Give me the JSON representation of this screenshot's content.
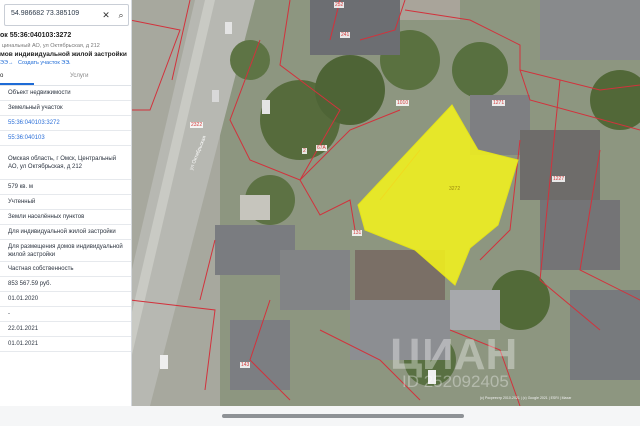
{
  "search": {
    "value": "54.986682 73.385109"
  },
  "panel": {
    "title": "ок 55:36:040103:3272",
    "subtitle": "цинальный АО, ул Октябрьская, д 212",
    "type_label": "мов индивидуальной жилой застройки",
    "links": [
      "ЭЭ",
      "Создать участок ЭЭ"
    ],
    "tabs": [
      {
        "label": "о"
      },
      {
        "label": "Услуги"
      }
    ],
    "rows": [
      {
        "text": "Объект недвижимости",
        "blue": false,
        "h": 1
      },
      {
        "text": "Земельный участок",
        "blue": false,
        "h": 1
      },
      {
        "text": "55:36:040103:3272",
        "blue": true,
        "h": 1
      },
      {
        "text": "55:36:040103",
        "blue": true,
        "h": 1
      },
      {
        "text": "Омская область, г Омск, Центральный АО, ул Октябрьская, д 212",
        "blue": false,
        "h": 3
      },
      {
        "text": "579 кв. м",
        "blue": false,
        "h": 1
      },
      {
        "text": "Учтенный",
        "blue": false,
        "h": 1
      },
      {
        "text": "Земли населённых пунктов",
        "blue": false,
        "h": 1
      },
      {
        "text": "Для индивидуальной жилой застройки",
        "blue": false,
        "h": 1
      },
      {
        "text": "Для размещения домов индивидуальной жилой застройки",
        "blue": false,
        "h": 2
      },
      {
        "text": "Частная собственность",
        "blue": false,
        "h": 1
      },
      {
        "text": "853 567.59 руб.",
        "blue": false,
        "h": 1
      },
      {
        "text": "01.01.2020",
        "blue": false,
        "h": 1
      },
      {
        "text": "-",
        "blue": false,
        "h": 1
      },
      {
        "text": "22.01.2021",
        "blue": false,
        "h": 1
      },
      {
        "text": "01.01.2021",
        "blue": false,
        "h": 1
      }
    ]
  },
  "map": {
    "labels": [
      "252",
      "241",
      "1010",
      "1271",
      "1227",
      "3272",
      "131",
      "67А",
      "2322",
      "143",
      "2",
      "1227"
    ],
    "street": "ул Октябрьская",
    "copyright": "(с) Росреестр 2010-2021 | (с) Google 2021 | ESRI | Maxar",
    "watermark": "ЦИАН",
    "watermark_id": "ID 252092405"
  },
  "colors": {
    "selected_parcel": "#f3f21c",
    "parcel_border": "#d2323c",
    "link": "#1e6bd6"
  }
}
